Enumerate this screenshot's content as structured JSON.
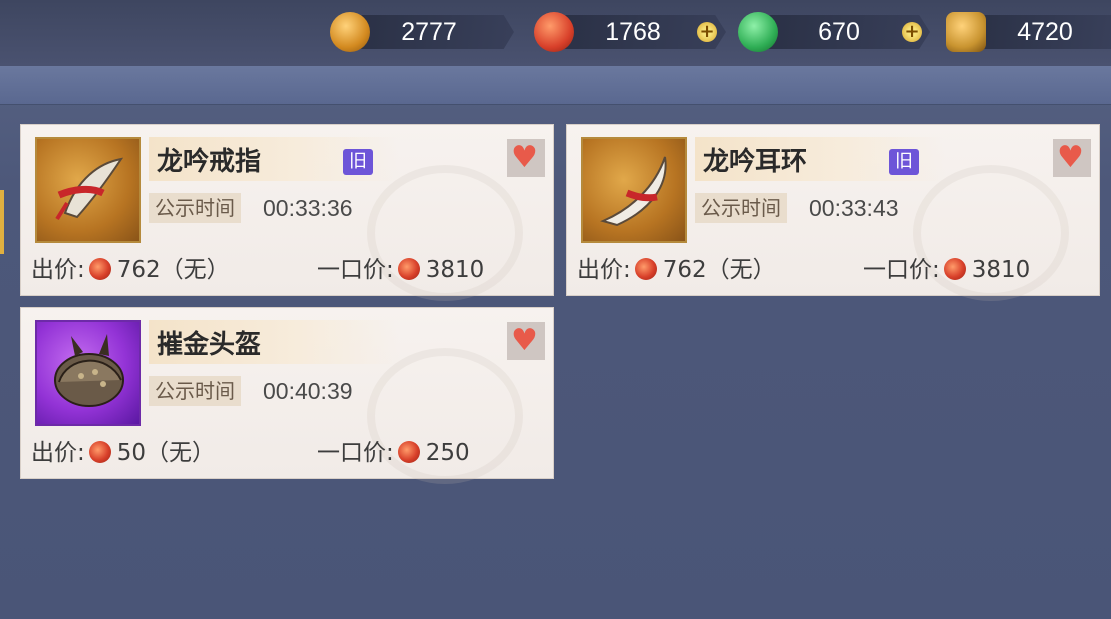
{
  "currencies": [
    {
      "name": "gold-coin",
      "value": "2777",
      "has_plus": false,
      "color": "#e6a33a"
    },
    {
      "name": "red-coin",
      "value": "1768",
      "has_plus": true,
      "color": "#d8402a"
    },
    {
      "name": "jade-coin",
      "value": "670",
      "has_plus": true,
      "color": "#2fae55"
    },
    {
      "name": "bronze-token",
      "value": "4720",
      "has_plus": false,
      "color": "#c99430"
    }
  ],
  "labels": {
    "publicity": "公示时间",
    "bid": "出价:",
    "buyout": "一口价:",
    "old_tag": "旧"
  },
  "items": [
    {
      "name": "龙吟戒指",
      "old": true,
      "timer": "00:33:36",
      "bid": "762（无）",
      "buyout": "3810",
      "icon": "ring-icon",
      "rarity_color": "#b77422"
    },
    {
      "name": "龙吟耳环",
      "old": true,
      "timer": "00:33:43",
      "bid": "762（无）",
      "buyout": "3810",
      "icon": "earring-icon",
      "rarity_color": "#b77422"
    },
    {
      "name": "摧金头盔",
      "old": false,
      "timer": "00:40:39",
      "bid": "50（无）",
      "buyout": "250",
      "icon": "helmet-icon",
      "rarity_color": "#9333d6"
    }
  ]
}
